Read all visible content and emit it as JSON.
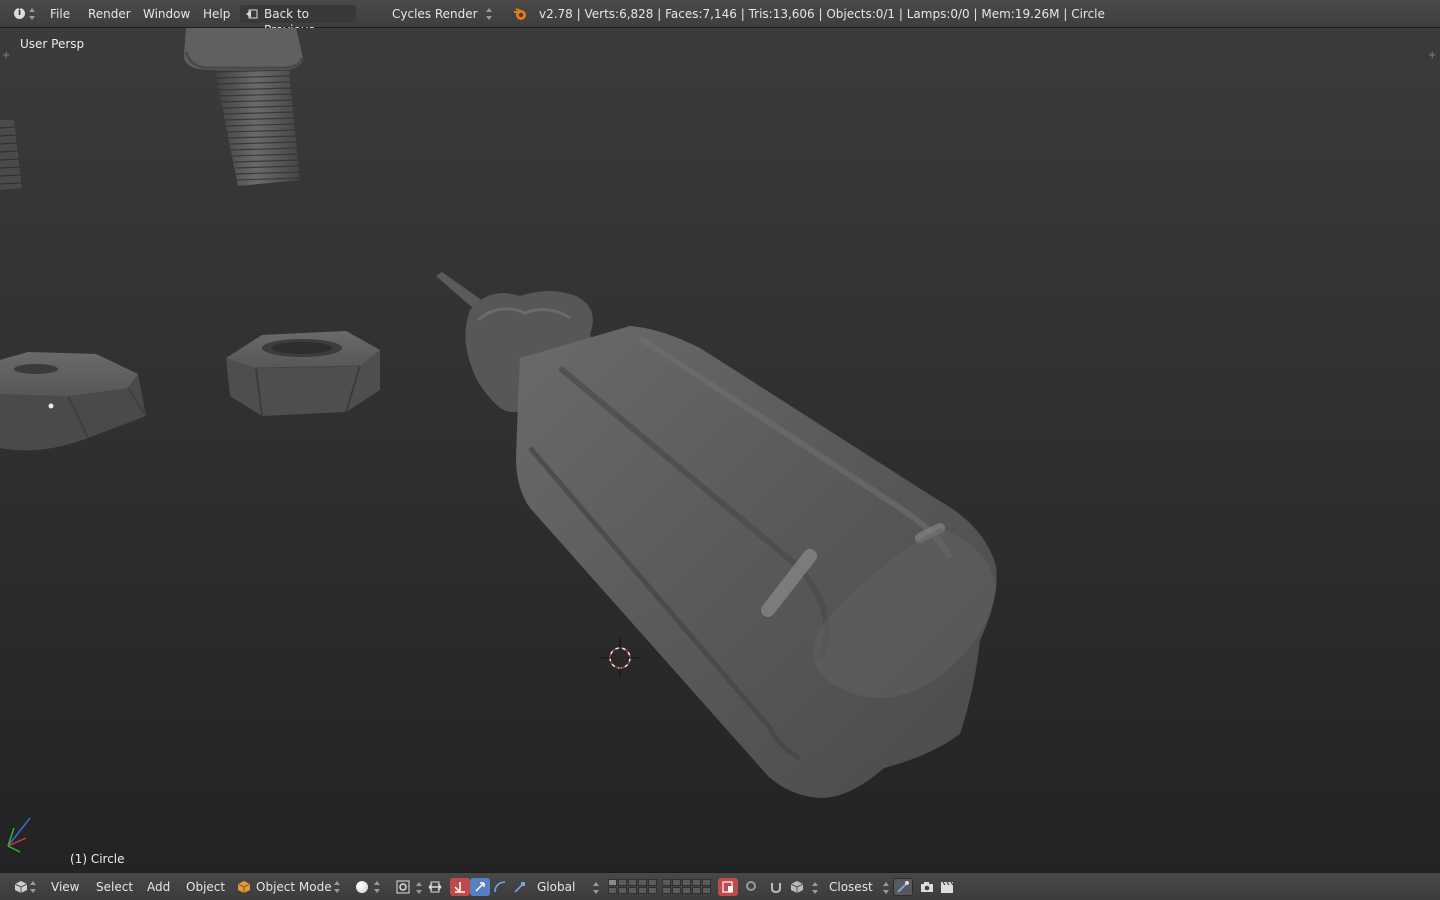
{
  "topbar": {
    "editor_icon": "info-icon",
    "menus": [
      "File",
      "Render",
      "Window",
      "Help"
    ],
    "back_button": "Back to Previous",
    "render_engine": "Cycles Render",
    "stats": "v2.78 | Verts:6,828 | Faces:7,146 | Tris:13,606 | Objects:0/1 | Lamps:0/0 | Mem:19.26M | Circle"
  },
  "viewport": {
    "view_label": "User Persp",
    "object_label": "(1) Circle"
  },
  "bottombar": {
    "editor_icon": "3d-view-icon",
    "menus": [
      "View",
      "Select",
      "Add",
      "Object"
    ],
    "mode": "Object Mode",
    "shading_icon": "solid-shading-icon",
    "orientation": "Global",
    "snap_target": "Closest"
  },
  "colors": {
    "header_bg": "#454545",
    "viewport_top": "#3b3b3b",
    "viewport_bottom": "#232323",
    "accent_blue": "#5680c2",
    "active_red": "#c04a4a",
    "mesh_gray": "#5a5a5a"
  }
}
